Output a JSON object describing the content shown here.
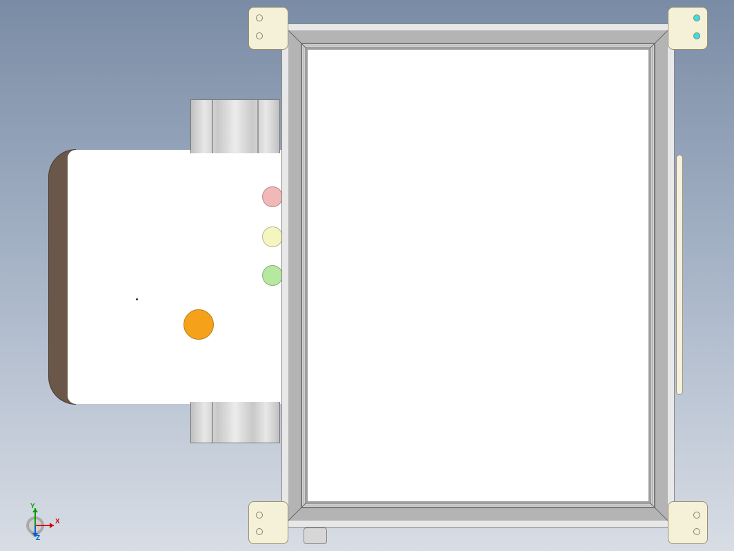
{
  "axes": {
    "x_label": "X",
    "y_label": "Y",
    "z_label": "Z",
    "x_color": "#d00000",
    "y_color": "#00a000",
    "z_color": "#0060d0"
  },
  "indicators": {
    "red": {
      "semantic": "status-light-red",
      "color": "#f2b8b8"
    },
    "yellow": {
      "semantic": "status-light-yellow",
      "color": "#f5f5c0"
    },
    "green": {
      "semantic": "status-light-green",
      "color": "#b6e8a0"
    },
    "orange": {
      "semantic": "pushbutton-orange",
      "color": "#f5a21a"
    }
  },
  "brackets": {
    "top_right_hole_color": "#34e0e8"
  }
}
